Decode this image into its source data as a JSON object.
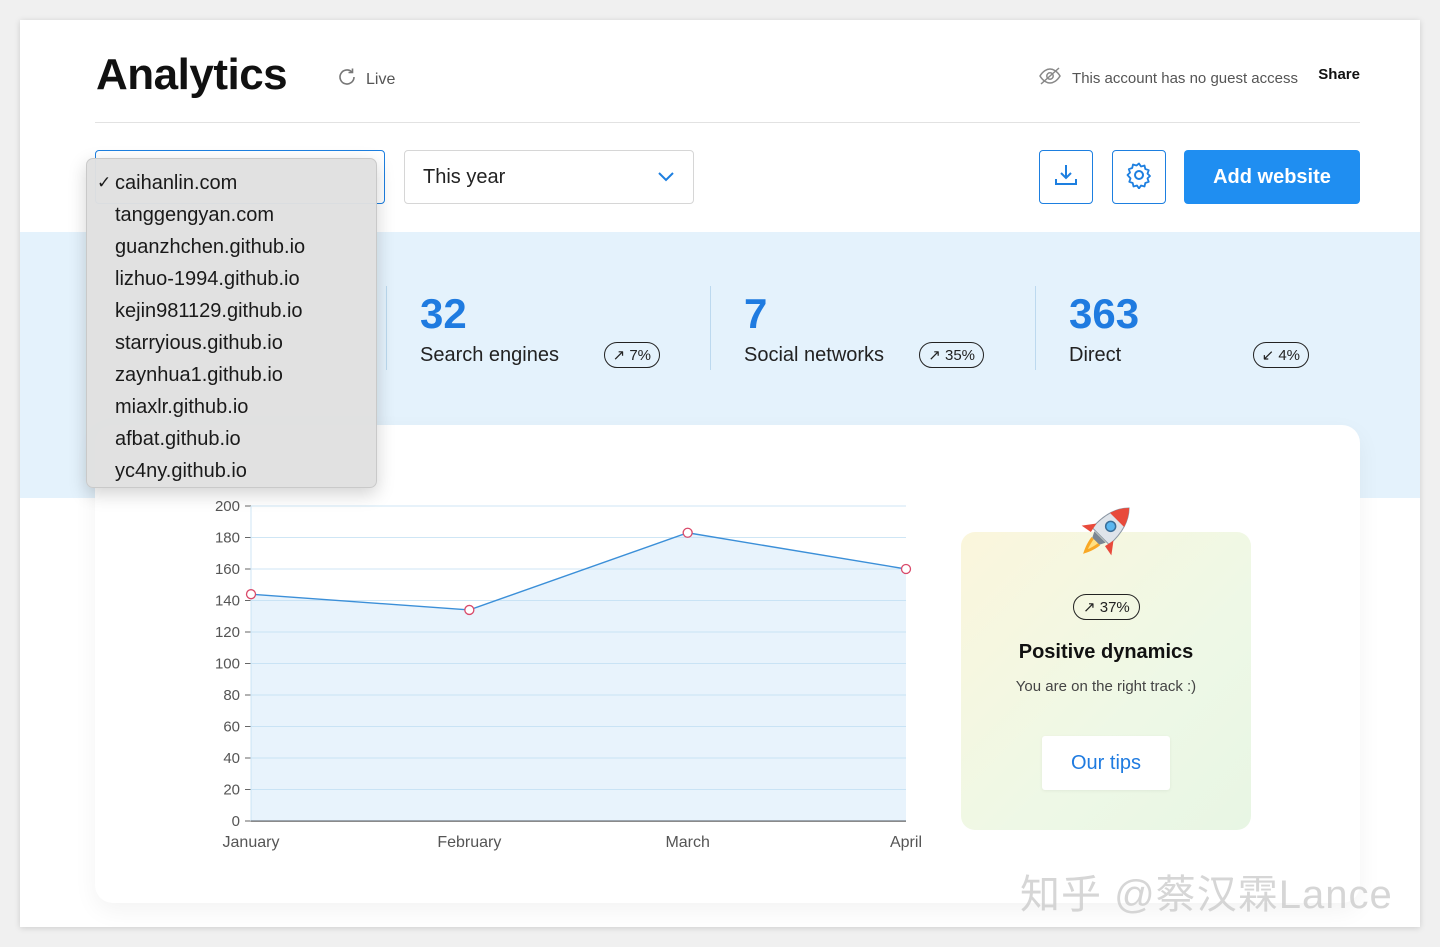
{
  "header": {
    "title": "Analytics",
    "live_label": "Live",
    "guest_notice": "This account has no guest access",
    "share_label": "Share"
  },
  "toolbar": {
    "selected_site": "caihanlin.com",
    "period": "This year",
    "add_website_label": "Add website"
  },
  "site_dropdown": {
    "items": [
      {
        "label": "caihanlin.com",
        "checked": true
      },
      {
        "label": "tanggengyan.com",
        "checked": false
      },
      {
        "label": "guanzhchen.github.io",
        "checked": false
      },
      {
        "label": "lizhuo-1994.github.io",
        "checked": false
      },
      {
        "label": "kejin981129.github.io",
        "checked": false
      },
      {
        "label": "starryious.github.io",
        "checked": false
      },
      {
        "label": "zaynhua1.github.io",
        "checked": false
      },
      {
        "label": "miaxlr.github.io",
        "checked": false
      },
      {
        "label": "afbat.github.io",
        "checked": false
      },
      {
        "label": "yc4ny.github.io",
        "checked": false
      }
    ],
    "check_glyph": "✓"
  },
  "stats": [
    {
      "value": "32",
      "label": "Search engines",
      "trend": "↗ 7%"
    },
    {
      "value": "7",
      "label": "Social networks",
      "trend": "↗ 35%"
    },
    {
      "value": "363",
      "label": "Direct",
      "trend": "↙ 4%"
    }
  ],
  "promo": {
    "trend": "↗ 37%",
    "title": "Positive dynamics",
    "subtitle": "You are on the right track :)",
    "button_label": "Our tips"
  },
  "chart_data": {
    "type": "area",
    "categories": [
      "January",
      "February",
      "March",
      "April"
    ],
    "values": [
      144,
      134,
      183,
      160
    ],
    "ylim": [
      0,
      200
    ],
    "yticks": [
      0,
      20,
      40,
      60,
      80,
      100,
      120,
      140,
      160,
      180,
      200
    ],
    "grid": true,
    "title": "",
    "xlabel": "",
    "ylabel": ""
  },
  "watermark": "知乎 @蔡汉霖Lance",
  "colors": {
    "accent": "#1f8ef1",
    "stat_value": "#1f7be0",
    "band": "#e4f2fc",
    "line": "#3b8fd8",
    "point": "#d94a6a"
  }
}
